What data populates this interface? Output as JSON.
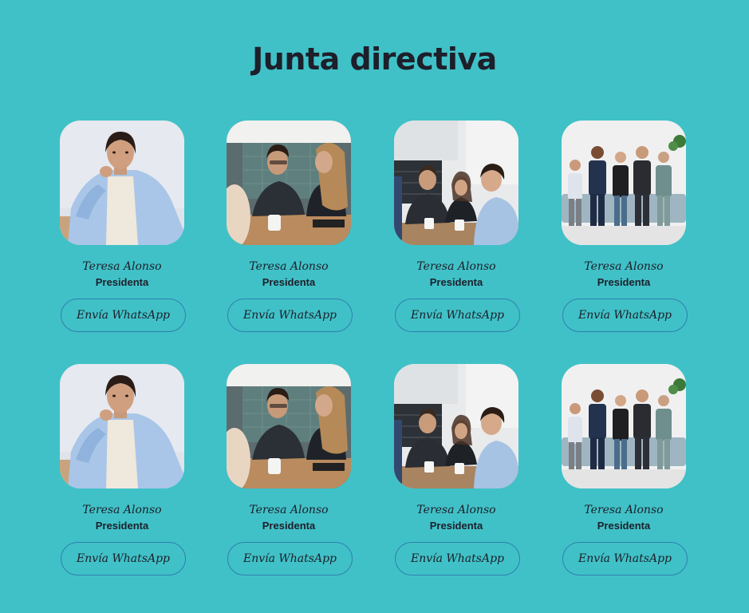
{
  "page": {
    "title": "Junta directiva",
    "background": "#40c1c7",
    "text_color": "#1d1f2a",
    "button_border": "#2f7fb0"
  },
  "members": [
    {
      "name": "Teresa Alonso",
      "role": "Presidenta",
      "button_label": "Envía WhatsApp",
      "photo": "woman-portrait-photo"
    },
    {
      "name": "Teresa Alonso",
      "role": "Presidenta",
      "button_label": "Envía WhatsApp",
      "photo": "meeting-table-photo"
    },
    {
      "name": "Teresa Alonso",
      "role": "Presidenta",
      "button_label": "Envía WhatsApp",
      "photo": "office-team-photo"
    },
    {
      "name": "Teresa Alonso",
      "role": "Presidenta",
      "button_label": "Envía WhatsApp",
      "photo": "group-standing-photo"
    },
    {
      "name": "Teresa Alonso",
      "role": "Presidenta",
      "button_label": "Envía WhatsApp",
      "photo": "woman-portrait-photo"
    },
    {
      "name": "Teresa Alonso",
      "role": "Presidenta",
      "button_label": "Envía WhatsApp",
      "photo": "meeting-table-photo"
    },
    {
      "name": "Teresa Alonso",
      "role": "Presidenta",
      "button_label": "Envía WhatsApp",
      "photo": "office-team-photo"
    },
    {
      "name": "Teresa Alonso",
      "role": "Presidenta",
      "button_label": "Envía WhatsApp",
      "photo": "group-standing-photo"
    }
  ]
}
